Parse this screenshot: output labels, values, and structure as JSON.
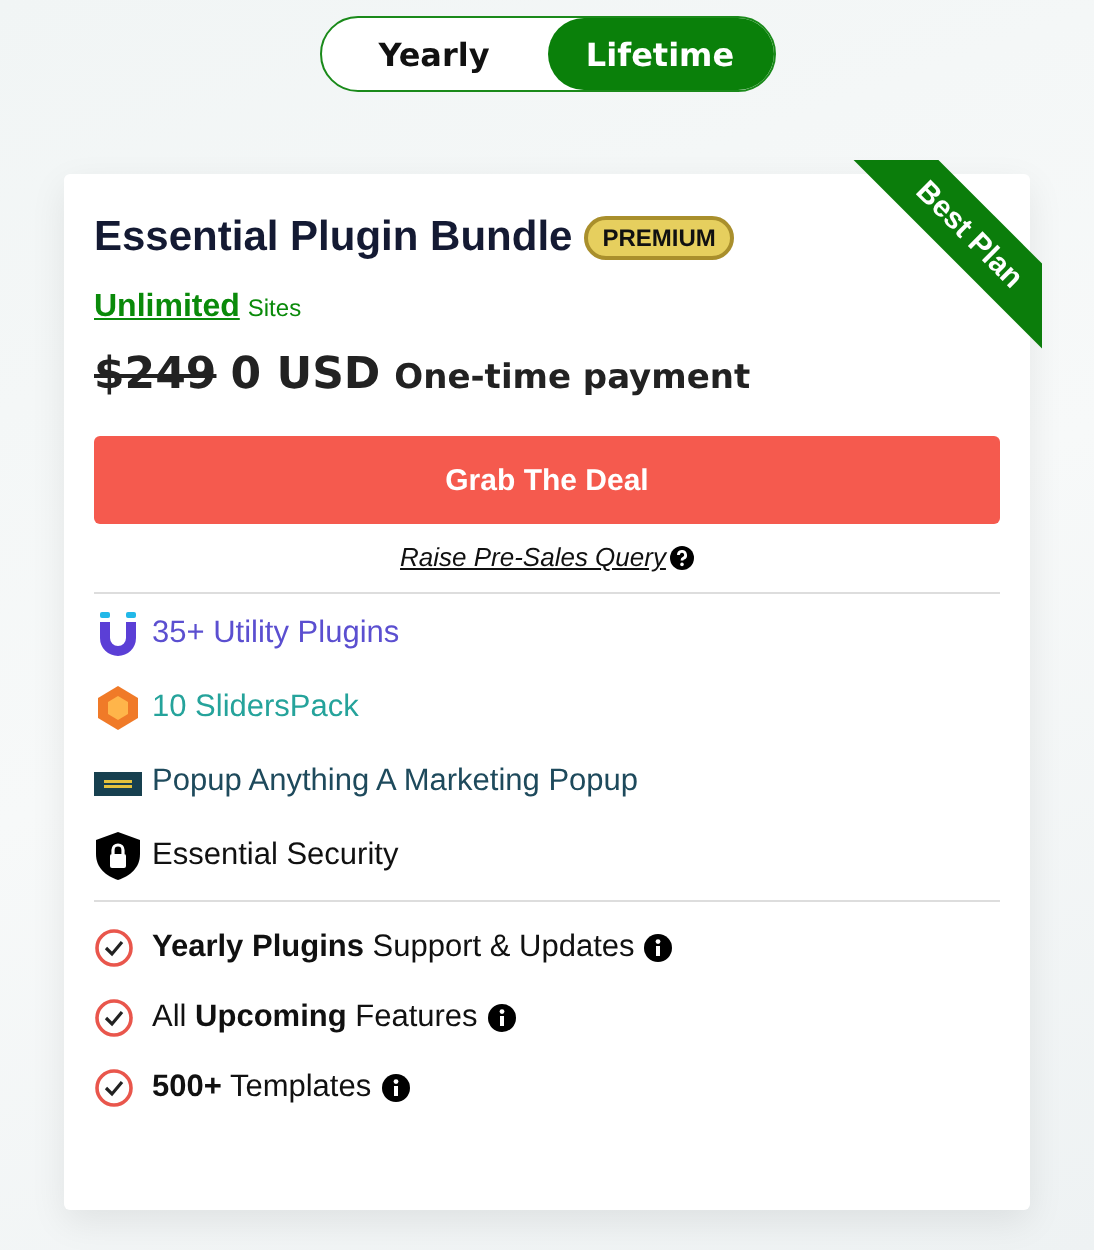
{
  "plan_toggle": [
    {
      "label": "Yearly",
      "selected": false
    },
    {
      "label": "Lifetime",
      "selected": true
    }
  ],
  "card": {
    "title": "Essential Plugin Bundle",
    "badge": "PREMIUM",
    "ribbon": "Best Plan",
    "sites": {
      "link": "Unlimited",
      "label": "Sites"
    },
    "price": {
      "old": "$249",
      "current": "0 USD",
      "note": "One-time payment"
    },
    "cta": "Grab The Deal",
    "query_link": "Raise Pre-Sales Query",
    "products": [
      {
        "kind": "utility",
        "label": "35+ Utility Plugins",
        "color": "#5b4fd0"
      },
      {
        "kind": "sliders",
        "label": "10 SlidersPack",
        "color": "#25a39b"
      },
      {
        "kind": "popup",
        "label": "Popup Anything A Marketing Popup",
        "color": "#1e4a5c"
      },
      {
        "kind": "security",
        "label": "Essential Security",
        "color": "#111111"
      }
    ],
    "features": [
      "**Yearly Plugins** Support & Updates",
      "All **Upcoming** Features",
      "**500+** Templates"
    ]
  }
}
